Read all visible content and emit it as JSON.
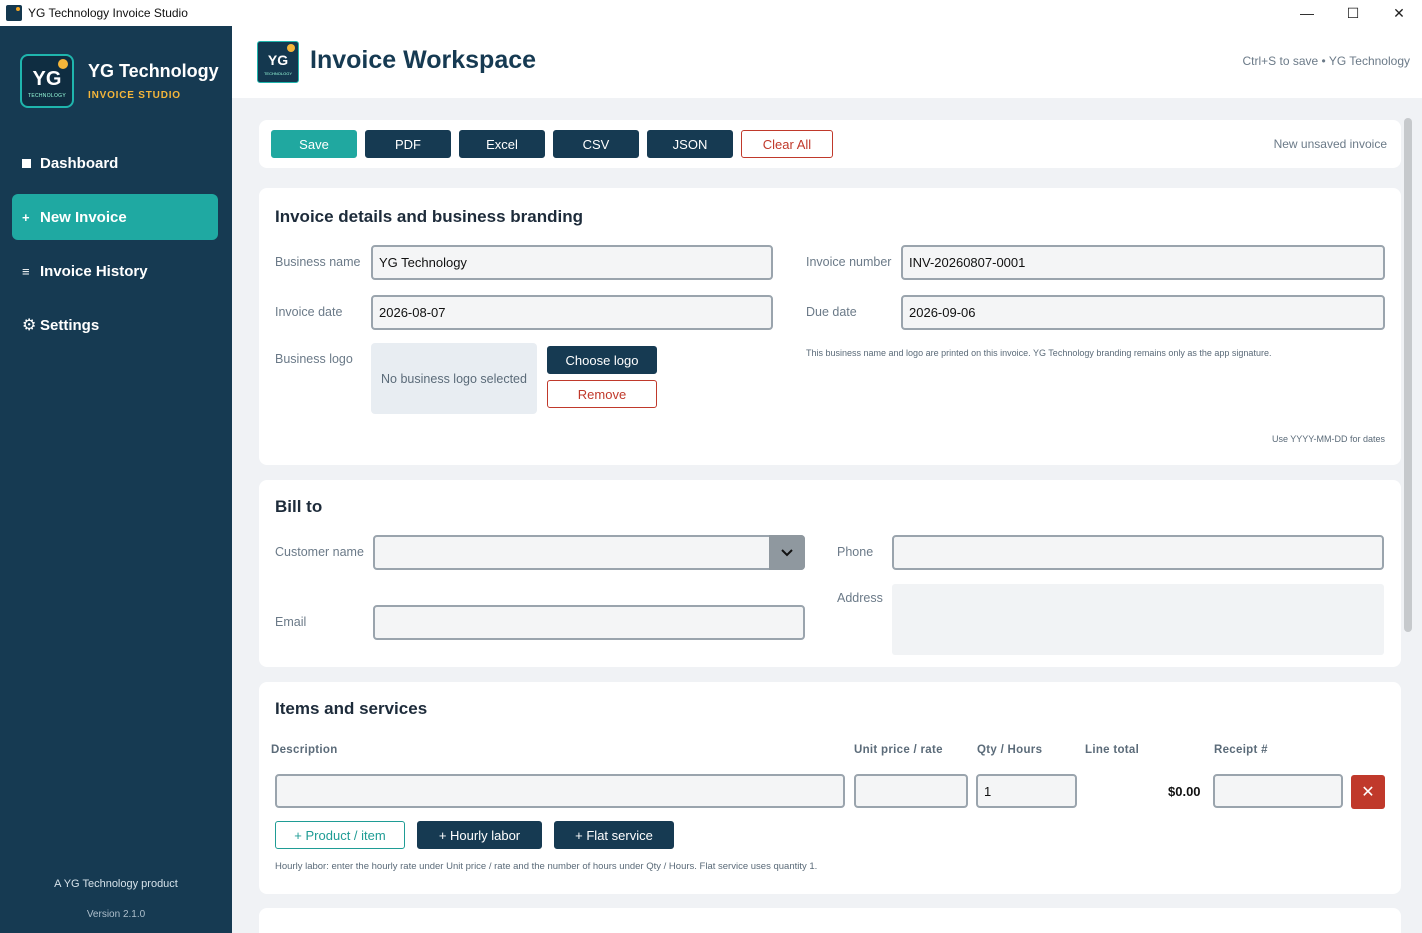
{
  "window": {
    "title": "YG Technology Invoice Studio",
    "controls": {
      "minimize": "—",
      "maximize": "☐",
      "close": "✕"
    }
  },
  "sidebar": {
    "brand_mark": "YG",
    "brand_mark_sub": "TECHNOLOGY",
    "brand_name": "YG Technology",
    "brand_sub": "INVOICE STUDIO",
    "items": [
      {
        "label": "Dashboard",
        "icon": "square-icon"
      },
      {
        "label": "New Invoice",
        "icon": "plus-icon",
        "glyph": "+"
      },
      {
        "label": "Invoice History",
        "icon": "list-icon",
        "glyph": "≡"
      },
      {
        "label": "Settings",
        "icon": "gear-icon",
        "glyph": "⚙"
      }
    ],
    "footer": "A YG Technology product",
    "version": "Version 2.1.0"
  },
  "header": {
    "logo_mark": "YG",
    "logo_sub": "TECHNOLOGY",
    "title": "Invoice Workspace",
    "hint": "Ctrl+S to save • YG Technology"
  },
  "toolbar": {
    "save": "Save",
    "pdf": "PDF",
    "excel": "Excel",
    "csv": "CSV",
    "json": "JSON",
    "clear": "Clear All",
    "status": "New unsaved invoice"
  },
  "details": {
    "title": "Invoice details and business branding",
    "business_name_label": "Business name",
    "business_name_value": "YG Technology",
    "invoice_number_label": "Invoice number",
    "invoice_number_value": "INV-20260807-0001",
    "invoice_date_label": "Invoice date",
    "invoice_date_value": "2026-08-07",
    "due_date_label": "Due date",
    "due_date_value": "2026-09-06",
    "logo_label": "Business logo",
    "logo_placeholder": "No business logo selected",
    "choose_logo": "Choose logo",
    "remove": "Remove",
    "branding_note": "This business name and logo are printed on this invoice. YG Technology branding remains only as the app signature.",
    "date_note": "Use YYYY-MM-DD for dates"
  },
  "bill_to": {
    "title": "Bill to",
    "customer_label": "Customer name",
    "customer_value": "",
    "phone_label": "Phone",
    "phone_value": "",
    "email_label": "Email",
    "email_value": "",
    "address_label": "Address",
    "address_value": ""
  },
  "items": {
    "title": "Items and services",
    "columns": [
      "Description",
      "Unit price / rate",
      "Qty / Hours",
      "Line total",
      "Receipt #"
    ],
    "row": {
      "description": "",
      "unit_price": "",
      "qty": "1",
      "line_total": "$0.00",
      "receipt": ""
    },
    "delete_glyph": "✕",
    "add_product": "+ Product / item",
    "add_hourly": "+ Hourly labor",
    "add_flat": "+ Flat service",
    "note": "Hourly labor: enter the hourly rate under Unit price / rate and the number of hours under Qty / Hours. Flat service uses quantity 1."
  },
  "colors": {
    "sidebar": "#163a52",
    "accent": "#1fa9a2",
    "brand_gold": "#f5b63a",
    "danger": "#c0392b"
  }
}
